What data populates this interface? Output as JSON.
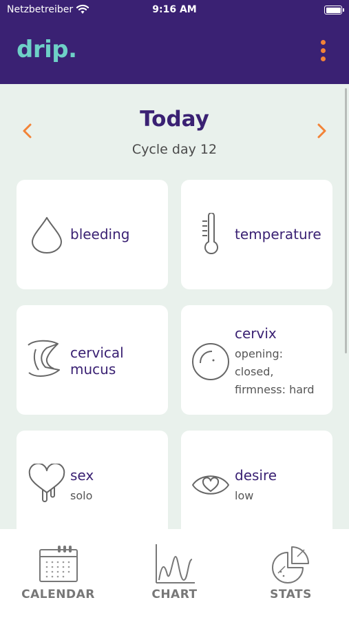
{
  "status_bar": {
    "carrier": "Netzbetreiber",
    "time": "9:16 AM"
  },
  "app": {
    "logo": "drip.",
    "accent_color": "#f38337",
    "brand_color": "#3a2173",
    "logo_color": "#6ed0c7"
  },
  "day_header": {
    "title": "Today",
    "cycle_day": "Cycle day 12"
  },
  "symptoms": [
    {
      "icon": "blood-drop-icon",
      "label": "bleeding",
      "details": []
    },
    {
      "icon": "thermometer-icon",
      "label": "temperature",
      "details": []
    },
    {
      "icon": "mucus-icon",
      "label_lines": [
        "cervical",
        "mucus"
      ],
      "details": []
    },
    {
      "icon": "cervix-icon",
      "label": "cervix",
      "details": [
        "opening:",
        "closed,",
        "firmness: hard"
      ]
    },
    {
      "icon": "heart-icon",
      "label": "sex",
      "details": [
        "solo"
      ]
    },
    {
      "icon": "eye-heart-icon",
      "label": "desire",
      "details": [
        "low"
      ]
    }
  ],
  "tabs": [
    {
      "icon": "calendar-icon",
      "label": "CALENDAR"
    },
    {
      "icon": "chart-icon",
      "label": "CHART"
    },
    {
      "icon": "stats-icon",
      "label": "STATS"
    }
  ]
}
